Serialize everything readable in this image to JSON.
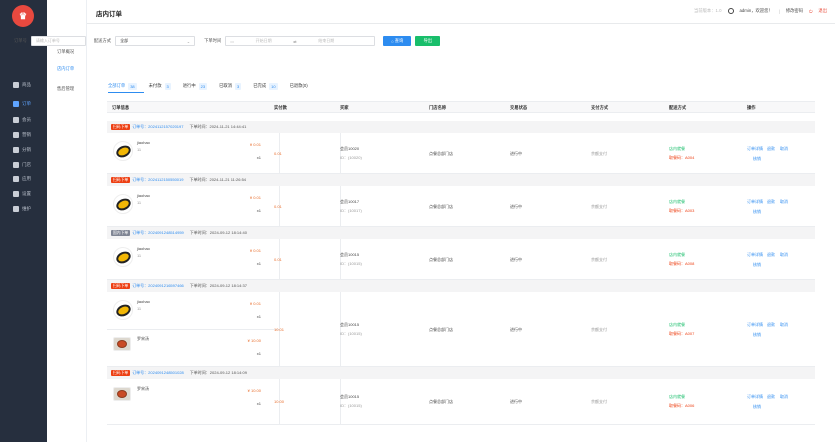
{
  "logo_char": "♛",
  "nav": [
    {
      "label": "商品",
      "active": false
    },
    {
      "label": "订单",
      "active": true
    },
    {
      "label": "会员",
      "active": false
    },
    {
      "label": "营销",
      "active": false
    },
    {
      "label": "分销",
      "active": false
    },
    {
      "label": "门店",
      "active": false
    },
    {
      "label": "应用",
      "active": false
    },
    {
      "label": "设置",
      "active": false
    },
    {
      "label": "维护",
      "active": false
    }
  ],
  "subnav": [
    {
      "label": "订单概况",
      "active": false
    },
    {
      "label": "店内订单",
      "active": true
    },
    {
      "label": "售后管理",
      "active": false
    }
  ],
  "page_title": "店内订单",
  "topbar": {
    "version": "当前版本：1.0",
    "admin": "admin，欢迎您！",
    "divider": "|",
    "change_pwd": "修改密码",
    "logout": "退出"
  },
  "filters": {
    "order_no_label": "订单号",
    "order_no_placeholder": "请输入订单号",
    "delivery_label": "配送方式",
    "delivery_value": "全部",
    "time_label": "下单时间",
    "start_placeholder": "开始日期",
    "end_placeholder": "结束日期",
    "search_btn": "查询",
    "export_btn": "导出"
  },
  "tabs": [
    {
      "label": "全部订单",
      "count": "38"
    },
    {
      "label": "未付款",
      "count": "3"
    },
    {
      "label": "进行中",
      "count": "23"
    },
    {
      "label": "已取消",
      "count": "3"
    },
    {
      "label": "已完成",
      "count": "10"
    },
    {
      "label": "已退款(0)",
      "count": ""
    }
  ],
  "columns": [
    "订单信息",
    "实付款",
    "买家",
    "门店名称",
    "交易状态",
    "支付方式",
    "配送方式",
    "操作"
  ],
  "orders": [
    {
      "tag": "扫码下单",
      "tag_color": "#ed4014",
      "no": "订单号：2024112157020197",
      "time": "下单时间：2024-11-21 14:44:41",
      "items": [
        {
          "name": "jiaohao",
          "sub": "11",
          "price": "¥ 0.01",
          "qty": "x1",
          "img": "logo"
        }
      ],
      "paid": "0.01",
      "buyer": "会员10020",
      "buyer_id": "ID：(10020)",
      "store": "点餐总部门店",
      "status": "进行中",
      "pay": "余额支付",
      "delivery": "店内就餐",
      "pickup": "取餐码：A004",
      "ops": [
        "订单详情",
        "退款",
        "取消"
      ],
      "op2": "核销"
    },
    {
      "tag": "扫码下单",
      "tag_color": "#ed4014",
      "no": "订单号：2024112150550019",
      "time": "下单时间：2024-11-21 11:26:54",
      "items": [
        {
          "name": "jiaohao",
          "sub": "11",
          "price": "¥ 0.01",
          "qty": "x1",
          "img": "logo"
        }
      ],
      "paid": "0.01",
      "buyer": "会员10017",
      "buyer_id": "ID：(10017)",
      "store": "点餐总部门店",
      "status": "进行中",
      "pay": "余额支付",
      "delivery": "店内就餐",
      "pickup": "取餐码：A003",
      "ops": [
        "订单详情",
        "退款",
        "取消"
      ],
      "op2": "核销"
    },
    {
      "tag": "国内下单",
      "tag_color": "#808695",
      "no": "订单号：2024091248514959",
      "time": "下单时间：2024-09-12 18:14:40",
      "items": [
        {
          "name": "jiaohao",
          "sub": "11",
          "price": "¥ 0.01",
          "qty": "x1",
          "img": "logo"
        }
      ],
      "paid": "0.01",
      "buyer": "会员10015",
      "buyer_id": "ID：(10015)",
      "store": "点餐总部门店",
      "status": "进行中",
      "pay": "余额支付",
      "delivery": "店内就餐",
      "pickup": "取餐码：A008",
      "ops": [
        "订单详情",
        "退款",
        "取消"
      ],
      "op2": "核销"
    },
    {
      "tag": "扫码下单",
      "tag_color": "#ed4014",
      "no": "订单号：2024091216597466",
      "time": "下单时间：2024-09-12 18:14:37",
      "items": [
        {
          "name": "jiaohao",
          "sub": "11",
          "price": "¥ 0.01",
          "qty": "x1",
          "img": "logo"
        },
        {
          "name": "罗宋汤",
          "sub": "",
          "price": "¥ 10.00",
          "qty": "x1",
          "img": "food"
        }
      ],
      "paid": "10.01",
      "buyer": "会员10015",
      "buyer_id": "ID：(10015)",
      "store": "点餐总部门店",
      "status": "进行中",
      "pay": "余额支付",
      "delivery": "店内就餐",
      "pickup": "取餐码：A007",
      "ops": [
        "订单详情",
        "退款",
        "取消"
      ],
      "op2": "核销"
    },
    {
      "tag": "扫码下单",
      "tag_color": "#ed4014",
      "no": "订单号：2024091248501028",
      "time": "下单时间：2024-09-12 18:14:09",
      "items": [
        {
          "name": "罗宋汤",
          "sub": "",
          "price": "¥ 10.00",
          "qty": "x1",
          "img": "food"
        }
      ],
      "paid": "10.00",
      "buyer": "会员10015",
      "buyer_id": "ID：(10015)",
      "store": "点餐总部门店",
      "status": "进行中",
      "pay": "余额支付",
      "delivery": "店内就餐",
      "pickup": "取餐码：A006",
      "ops": [
        "订单详情",
        "退款",
        "取消"
      ],
      "op2": "核销"
    }
  ]
}
